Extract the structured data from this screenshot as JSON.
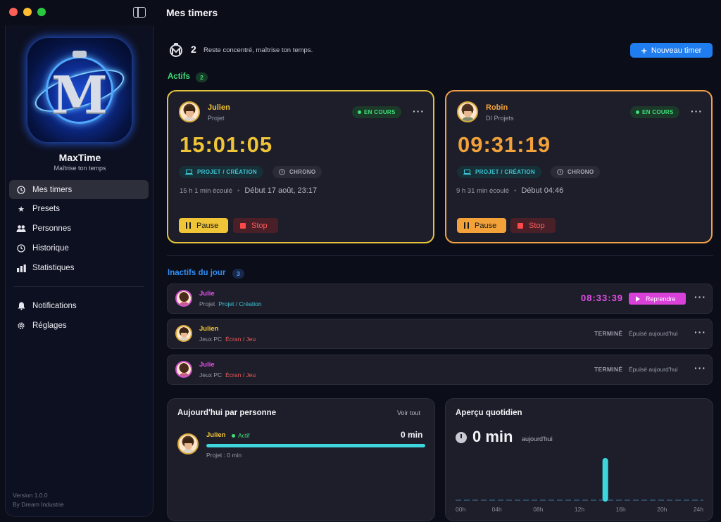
{
  "window": {
    "title": "Mes timers"
  },
  "app": {
    "name": "MaxTime",
    "tagline": "Maîtrise ton temps",
    "version": "Version 1.0.0",
    "credit": "By Dream Industrie"
  },
  "nav": {
    "items": [
      {
        "label": "Mes timers",
        "icon": "clock-icon",
        "active": true
      },
      {
        "label": "Presets",
        "icon": "star-icon"
      },
      {
        "label": "Personnes",
        "icon": "people-icon"
      },
      {
        "label": "Historique",
        "icon": "history-icon"
      },
      {
        "label": "Statistiques",
        "icon": "bar-chart-icon"
      }
    ],
    "secondary": [
      {
        "label": "Notifications",
        "icon": "bell-icon"
      },
      {
        "label": "Réglages",
        "icon": "gear-icon"
      }
    ]
  },
  "header": {
    "count": "2",
    "subtitle": "Reste concentré, maîtrise ton temps.",
    "new_button": "Nouveau timer"
  },
  "active": {
    "title": "Actifs",
    "count": "2",
    "cards": [
      {
        "name": "Julien",
        "sub": "Projet",
        "status": "EN COURS",
        "time": "15:01:05",
        "category": "PROJET / CRÉATION",
        "mode": "CHRONO",
        "elapsed": "15 h 1 min écoulé",
        "start": "Début 17 août, 23:17",
        "pause": "Pause",
        "stop": "Stop",
        "accent": "#f0c437"
      },
      {
        "name": "Robin",
        "sub": "DI Projets",
        "status": "EN COURS",
        "time": "09:31:19",
        "category": "PROJET / CRÉATION",
        "mode": "CHRONO",
        "elapsed": "9 h 31 min écoulé",
        "start": "Début 04:46",
        "pause": "Pause",
        "stop": "Stop",
        "accent": "#f3a23a"
      }
    ]
  },
  "inactive": {
    "title": "Inactifs du jour",
    "count": "3",
    "rows": [
      {
        "name": "Julie",
        "sub": "Projet",
        "category": "Projet / Création",
        "time": "08:33:39",
        "action": "Reprendre"
      },
      {
        "name": "Julien",
        "sub": "Jeux PC",
        "category": "Écran / Jeu",
        "status": "TERMINÉ",
        "note": "Épuisé aujourd'hui"
      },
      {
        "name": "Julie",
        "sub": "Jeux PC",
        "category": "Écran / Jeu",
        "status": "TERMINÉ",
        "note": "Épuisé aujourd'hui"
      }
    ]
  },
  "today_panel": {
    "title": "Aujourd'hui par personne",
    "see_all": "Voir tout",
    "person": {
      "name": "Julien",
      "status": "Actif",
      "minutes": "0 min",
      "sub": "Projet : 0 min",
      "progress": 1.0
    }
  },
  "overview_panel": {
    "title": "Aperçu quotidien",
    "value": "0 min",
    "label": "aujourd'hui"
  },
  "chart_data": {
    "type": "bar",
    "x_ticks": [
      "00h",
      "04h",
      "08h",
      "12h",
      "16h",
      "20h",
      "24h"
    ],
    "bins": 24,
    "highlight_hour": 14,
    "highlight_value": 1
  },
  "colors": {
    "accent_blue": "#1f7df0",
    "active_green": "#3fe07a",
    "julien_yellow": "#f0c437",
    "robin_orange": "#f3a23a",
    "julie_pink": "#e34fe6",
    "teal": "#3dd6dc"
  }
}
